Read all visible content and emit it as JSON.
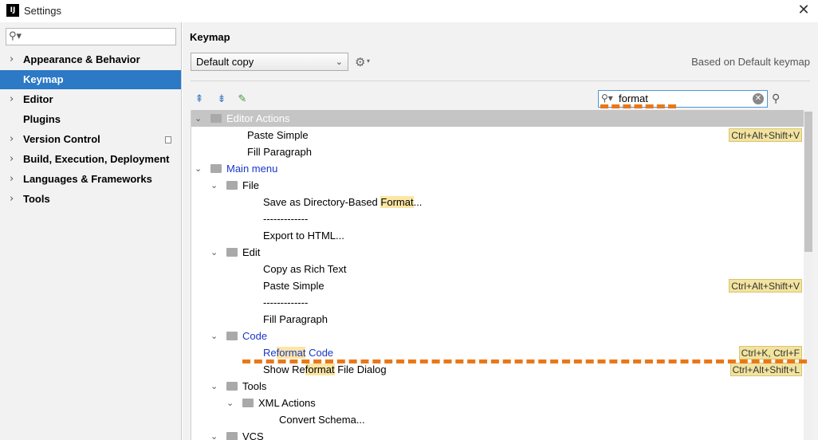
{
  "window": {
    "app_icon": "IJ",
    "title": "Settings",
    "close_glyph": "✕"
  },
  "sidebar": {
    "search_placeholder": "",
    "search_icon": "search-icon",
    "items": [
      {
        "label": "Appearance & Behavior",
        "expandable": true
      },
      {
        "label": "Keymap",
        "expandable": false,
        "selected": true
      },
      {
        "label": "Editor",
        "expandable": true
      },
      {
        "label": "Plugins",
        "expandable": false
      },
      {
        "label": "Version Control",
        "expandable": true
      },
      {
        "label": "Build, Execution, Deployment",
        "expandable": true
      },
      {
        "label": "Languages & Frameworks",
        "expandable": true
      },
      {
        "label": "Tools",
        "expandable": true
      }
    ]
  },
  "main": {
    "title": "Keymap",
    "keymap_select": "Default copy",
    "based_on": "Based on Default keymap",
    "search_value": "format",
    "tree": [
      {
        "level": 0,
        "type": "group",
        "label": "Editor Actions",
        "expanded": true,
        "greyed": true
      },
      {
        "level": 1,
        "type": "action",
        "label": "Paste Simple",
        "shortcut": "Ctrl+Alt+Shift+V"
      },
      {
        "level": 1,
        "type": "action",
        "label": "Fill Paragraph"
      },
      {
        "level": 0,
        "type": "group",
        "label": "Main menu",
        "expanded": true,
        "blue": true
      },
      {
        "level": 1,
        "type": "folder",
        "label": "File",
        "expanded": true
      },
      {
        "level": 2,
        "type": "action",
        "label_pre": "Save as Directory-Based ",
        "label_hl": "Format",
        "label_post": "..."
      },
      {
        "level": 2,
        "type": "action",
        "label": "-------------"
      },
      {
        "level": 2,
        "type": "action",
        "label": "Export to HTML..."
      },
      {
        "level": 1,
        "type": "folder",
        "label": "Edit",
        "expanded": true
      },
      {
        "level": 2,
        "type": "action",
        "label": "Copy as Rich Text"
      },
      {
        "level": 2,
        "type": "action",
        "label": "Paste Simple",
        "shortcut": "Ctrl+Alt+Shift+V"
      },
      {
        "level": 2,
        "type": "action",
        "label": "-------------"
      },
      {
        "level": 2,
        "type": "action",
        "label": "Fill Paragraph"
      },
      {
        "level": 1,
        "type": "folder",
        "label": "Code",
        "expanded": true,
        "blue": true
      },
      {
        "level": 2,
        "type": "action",
        "label_pre": "Re",
        "label_hl": "format",
        "label_post": " Code",
        "shortcut": "Ctrl+K, Ctrl+F",
        "blue": true
      },
      {
        "level": 2,
        "type": "action",
        "label_pre": "Show Re",
        "label_hl": "format",
        "label_post": " File Dialog",
        "shortcut": "Ctrl+Alt+Shift+L"
      },
      {
        "level": 1,
        "type": "folder",
        "label": "Tools",
        "expanded": true
      },
      {
        "level": 2,
        "type": "folder",
        "label": "XML Actions",
        "expanded": true
      },
      {
        "level": 3,
        "type": "action",
        "label": "Convert Schema..."
      },
      {
        "level": 1,
        "type": "folder",
        "label": "VCS",
        "expanded": true
      }
    ]
  },
  "colors": {
    "selection": "#2c79c6",
    "highlight": "#fbe6a4",
    "shortcut_bg": "#f2e39f",
    "link_blue": "#1a37c8",
    "annotation_orange": "#e87819"
  }
}
